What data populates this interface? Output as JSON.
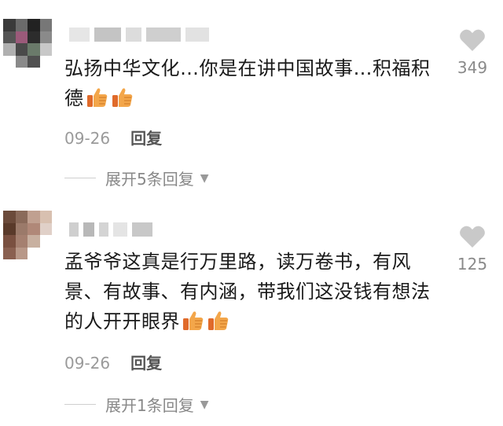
{
  "comments": [
    {
      "text": "弘扬中华文化…你是在讲中国故事…积福积德",
      "date": "09-26",
      "reply_label": "回复",
      "likes": "349",
      "expand_label": "展开5条回复",
      "thumbs_emoji_count": 2
    },
    {
      "text": "孟爷爷这真是行万里路，读万卷书，有风景、有故事、有内涵，带我们这没钱有想法的人开开眼界",
      "date": "09-26",
      "reply_label": "回复",
      "likes": "125",
      "expand_label": "展开1条回复",
      "thumbs_emoji_count": 2
    }
  ],
  "icons": {
    "like": "heart-icon",
    "expand": "caret-down-icon",
    "emoji": "thumbs-up-icon"
  },
  "colors": {
    "text": "#1a1a1a",
    "meta": "#9a9a9a",
    "heart": "#c9c9c9",
    "thumb": "#f3a64a"
  }
}
